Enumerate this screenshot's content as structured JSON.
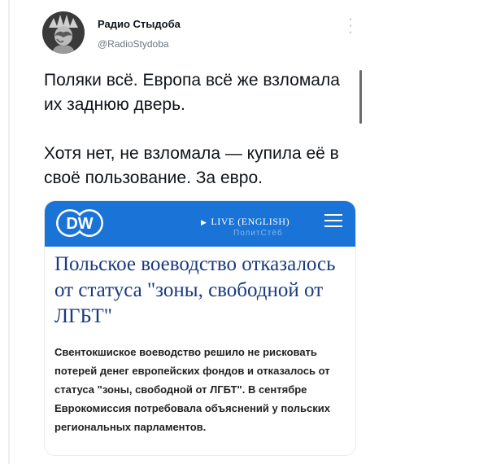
{
  "tweet": {
    "author_name": "Радио Стыдоба",
    "author_handle": "@RadioStydoba",
    "more_icon": "more-vertical-icon",
    "paragraph_1": "Поляки всё. Европа всё же взломала их заднюю дверь.",
    "paragraph_2": "Хотя нет, не взломала — купила её в своё пользование. За евро."
  },
  "card": {
    "brand_logo": "DW",
    "brand_color": "#1a73d6",
    "live_label": "LIVE (ENGLISH)",
    "watermark": "ПолитСтёб",
    "menu_icon": "hamburger-menu-icon",
    "headline": "Польское воеводство отказалось от статуса \"зоны, свободной от ЛГБТ\"",
    "summary": "Свентокшиское воеводство решило не рисковать потерей денег европейских фондов и отказалось от статуса \"зоны, свободной от ЛГБТ\". В сентябре Еврокомиссия потребовала объяснений у польских региональных парламентов."
  }
}
